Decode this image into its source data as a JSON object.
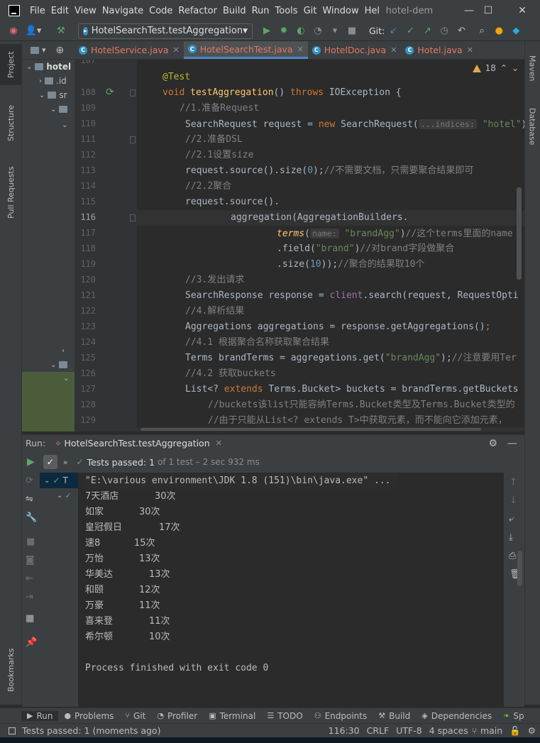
{
  "window": {
    "menu": [
      "File",
      "Edit",
      "View",
      "Navigate",
      "Code",
      "Refactor",
      "Build",
      "Run",
      "Tools",
      "Git",
      "Window",
      "Help"
    ],
    "title": "hotel-dem"
  },
  "toolbar": {
    "run_config": "HotelSearchTest.testAggregation",
    "git_label": "Git:"
  },
  "left_tools": [
    "Project",
    "Structure",
    "Pull Requests",
    "Bookmarks"
  ],
  "right_tools": [
    "Maven",
    "Database"
  ],
  "project_tree": [
    "hotel",
    ".id",
    "sr"
  ],
  "editor_tabs": [
    {
      "label": "HotelService.java",
      "active": false
    },
    {
      "label": "HotelSearchTest.java",
      "active": true
    },
    {
      "label": "HotelDoc.java",
      "active": false
    },
    {
      "label": "Hotel.java",
      "active": false
    }
  ],
  "editor": {
    "warnings": "18",
    "line_numbers": [
      "107",
      "108",
      "109",
      "110",
      "111",
      "112",
      "113",
      "114",
      "115",
      "116",
      "117",
      "118",
      "119",
      "120",
      "121",
      "122",
      "123",
      "124",
      "125",
      "126",
      "127",
      "128",
      "129"
    ],
    "current_line": "116",
    "hints": {
      "indices": "...indices:",
      "name": "name:"
    },
    "code": {
      "l107": "@Test",
      "l108_void": "void ",
      "l108_fn": "testAggregation",
      "l108_mid": "() ",
      "l108_throws": "throws",
      "l108_rest": " IOException {",
      "l109": "//1.准备Request",
      "l110_a": "SearchRequest request = ",
      "l110_new": "new",
      "l110_b": " SearchRequest(",
      "l110_str": "\"hotel\"",
      "l110_c": ");",
      "l111": "//2.准备DSL",
      "l112": "//2.1设置size",
      "l113_a": "request.source().size(",
      "l113_num": "0",
      "l113_b": ");",
      "l113_cmt": "//不需要文档，只需要聚合结果即可",
      "l114": "//2.2聚合",
      "l115": "request.source().",
      "l116": "aggregation(AggregationBuilders.",
      "l117_fn": "terms",
      "l117_a": "(",
      "l117_str": "\"brandAgg\"",
      "l117_b": ")",
      "l117_cmt": "//这个terms里面的name",
      "l118_a": ".field(",
      "l118_str": "\"brand\"",
      "l118_b": ")",
      "l118_cmt": "//对brand字段做聚合",
      "l119_a": ".size(",
      "l119_num": "10",
      "l119_b": "));",
      "l119_cmt": "//聚合的结果取10个",
      "l120": "//3.发出请求",
      "l121_a": "SearchResponse response = ",
      "l121_fld": "client",
      "l121_b": ".search(request, RequestOpti",
      "l122": "//4.解析结果",
      "l123_a": "Aggregations aggregations = response.getAggregations()",
      "l123_b": ";",
      "l124": "//4.1 根据聚合名称获取聚合结果",
      "l125_a": "Terms brandTerms = aggregations.get(",
      "l125_str": "\"brandAgg\"",
      "l125_b": ");",
      "l125_cmt": "//注意要用Ter",
      "l126": "//4.2 获取buckets",
      "l127_a": "List<? ",
      "l127_kw": "extends",
      "l127_b": " Terms.Bucket> buckets = brandTerms.getBuckets",
      "l128": "//buckets该list只能容纳Terms.Bucket类型及Terms.Bucket类型的",
      "l129": "//由于只能从List<? extends T>中获取元素，而不能向它添加元素，"
    }
  },
  "run_panel": {
    "label": "Run:",
    "tab": "HotelSearchTest.testAggregation",
    "status_passed": "Tests passed:",
    "status_count": "1",
    "status_detail": "of 1 test – 2 sec 932 ms",
    "tree_label": "T",
    "console": {
      "cmd": "\"E:\\various environment\\JDK 1.8 (151)\\bin\\java.exe\" ...",
      "results": [
        {
          "name": "7天酒店",
          "count": "30次"
        },
        {
          "name": "如家",
          "count": "30次"
        },
        {
          "name": "皇冠假日",
          "count": "17次"
        },
        {
          "name": "速8",
          "count": "15次"
        },
        {
          "name": "万怡",
          "count": "13次"
        },
        {
          "name": "华美达",
          "count": "13次"
        },
        {
          "name": "和颐",
          "count": "12次"
        },
        {
          "name": "万豪",
          "count": "11次"
        },
        {
          "name": "喜来登",
          "count": "11次"
        },
        {
          "name": "希尔顿",
          "count": "10次"
        }
      ],
      "exit": "Process finished with exit code 0"
    }
  },
  "bottom_tabs": [
    "Run",
    "Problems",
    "Git",
    "Profiler",
    "Terminal",
    "TODO",
    "Endpoints",
    "Build",
    "Dependencies",
    "Sp"
  ],
  "status": {
    "message": "Tests passed: 1 (moments ago)",
    "position": "116:30",
    "line_sep": "CRLF",
    "encoding": "UTF-8",
    "indent": "4 spaces",
    "branch": "main"
  },
  "colors": {
    "accent": "#4a88c7",
    "pass": "#59a869",
    "error_tab": "#e17961"
  }
}
